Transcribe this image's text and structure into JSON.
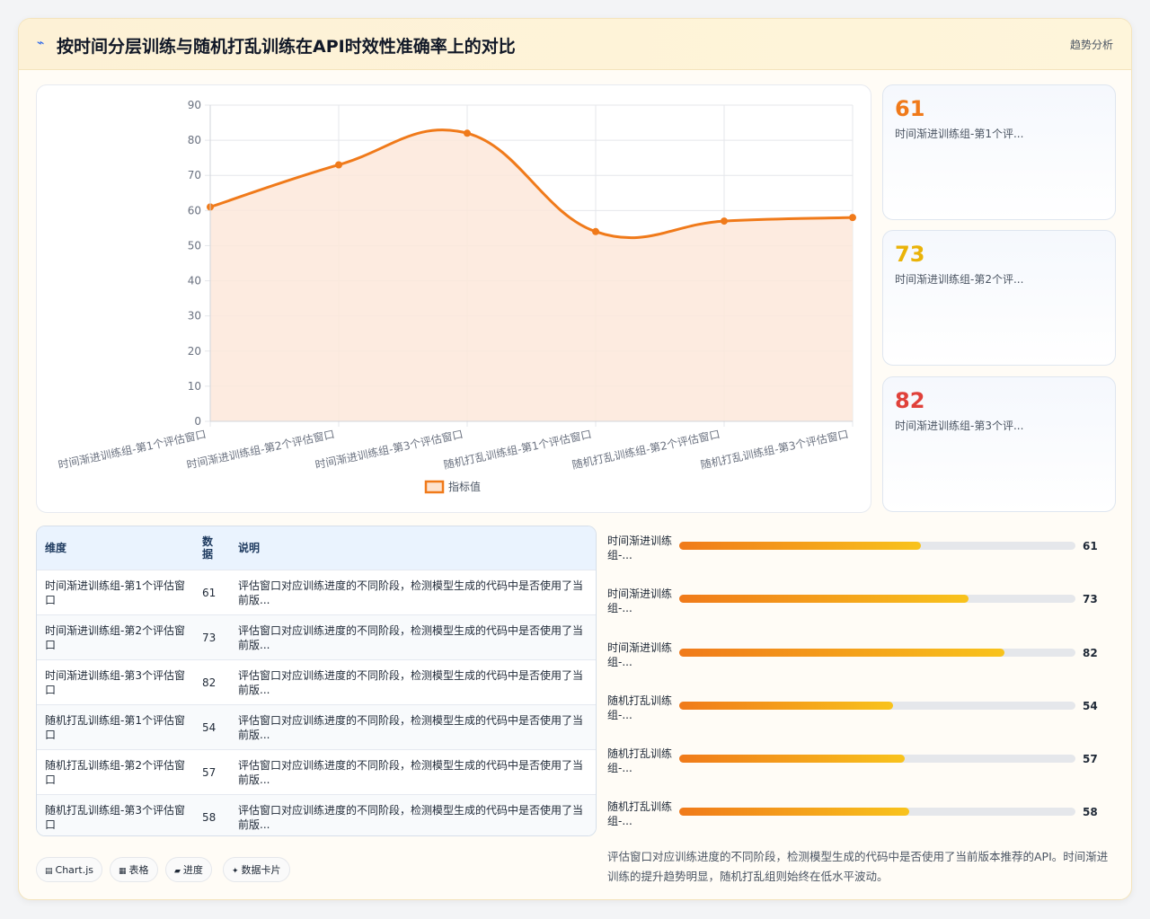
{
  "header": {
    "icon": "chart-line-icon",
    "title": "按时间分层训练与随机打乱训练在API时效性准确率上的对比",
    "tag": "趋势分析"
  },
  "colors": {
    "accent": "#f07a1a",
    "fill": "#fde8da",
    "grid": "#e5e7eb",
    "stat1": "#f07a1a",
    "stat2": "#eab308",
    "stat3": "#e0413a"
  },
  "chart_data": {
    "type": "line",
    "categories": [
      "时间渐进训练组-第1个评估窗口",
      "时间渐进训练组-第2个评估窗口",
      "时间渐进训练组-第3个评估窗口",
      "随机打乱训练组-第1个评估窗口",
      "随机打乱训练组-第2个评估窗口",
      "随机打乱训练组-第3个评估窗口"
    ],
    "series": [
      {
        "name": "指标值",
        "values": [
          61,
          73,
          82,
          54,
          57,
          58
        ]
      }
    ],
    "ylim": [
      0,
      90
    ],
    "yticks": [
      0,
      10,
      20,
      30,
      40,
      50,
      60,
      70,
      80,
      90
    ],
    "grid": true,
    "legend": "bottom",
    "fill": true
  },
  "stats": [
    {
      "value": "61",
      "label": "时间渐进训练组-第1个评..."
    },
    {
      "value": "73",
      "label": "时间渐进训练组-第2个评..."
    },
    {
      "value": "82",
      "label": "时间渐进训练组-第3个评..."
    }
  ],
  "table": {
    "headers": [
      "维度",
      "数据",
      "说明"
    ],
    "rows": [
      {
        "dim": "时间渐进训练组-第1个评估窗口",
        "val": "61",
        "desc": "评估窗口对应训练进度的不同阶段，检测模型生成的代码中是否使用了当前版..."
      },
      {
        "dim": "时间渐进训练组-第2个评估窗口",
        "val": "73",
        "desc": "评估窗口对应训练进度的不同阶段，检测模型生成的代码中是否使用了当前版..."
      },
      {
        "dim": "时间渐进训练组-第3个评估窗口",
        "val": "82",
        "desc": "评估窗口对应训练进度的不同阶段，检测模型生成的代码中是否使用了当前版..."
      },
      {
        "dim": "随机打乱训练组-第1个评估窗口",
        "val": "54",
        "desc": "评估窗口对应训练进度的不同阶段，检测模型生成的代码中是否使用了当前版..."
      },
      {
        "dim": "随机打乱训练组-第2个评估窗口",
        "val": "57",
        "desc": "评估窗口对应训练进度的不同阶段，检测模型生成的代码中是否使用了当前版..."
      },
      {
        "dim": "随机打乱训练组-第3个评估窗口",
        "val": "58",
        "desc": "评估窗口对应训练进度的不同阶段，检测模型生成的代码中是否使用了当前版..."
      }
    ]
  },
  "progress": [
    {
      "label": "时间渐进训练组-...",
      "value": 61
    },
    {
      "label": "时间渐进训练组-...",
      "value": 73
    },
    {
      "label": "时间渐进训练组-...",
      "value": 82
    },
    {
      "label": "随机打乱训练组-...",
      "value": 54
    },
    {
      "label": "随机打乱训练组-...",
      "value": 57
    },
    {
      "label": "随机打乱训练组-...",
      "value": 58
    }
  ],
  "note": "评估窗口对应训练进度的不同阶段，检测模型生成的代码中是否使用了当前版本推荐的API。时间渐进训练的提升趋势明显，随机打乱组则始终在低水平波动。",
  "chips": [
    {
      "icon": "chart-icon",
      "glyph": "▤",
      "label": "Chart.js"
    },
    {
      "icon": "table-icon",
      "glyph": "▦",
      "label": "表格"
    },
    {
      "icon": "progress-icon",
      "glyph": "▰",
      "label": "进度"
    },
    {
      "icon": "card-icon",
      "glyph": "✦",
      "label": "数据卡片"
    }
  ]
}
